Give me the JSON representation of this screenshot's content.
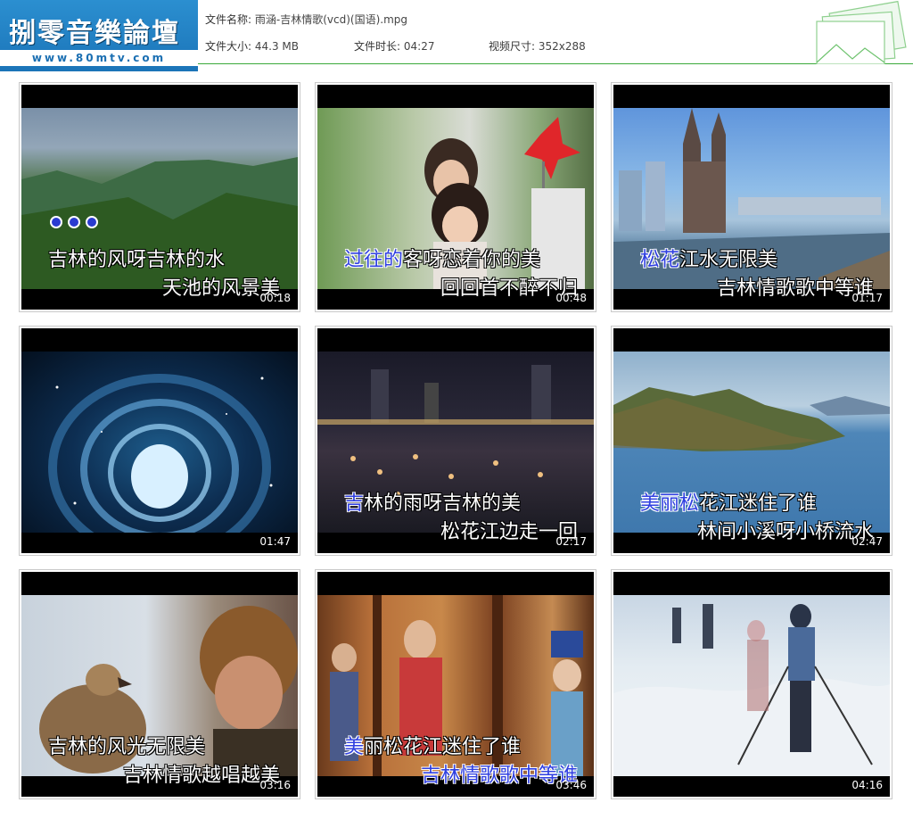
{
  "logo": {
    "title": "捌零音樂論壇",
    "url": "www.80mtv.com"
  },
  "file": {
    "name_label": "文件名称:",
    "name": "雨涵-吉林情歌(vcd)(国语).mpg",
    "size_label": "文件大小:",
    "size": "44.3 MB",
    "duration_label": "文件时长:",
    "duration": "04:27",
    "resolution_label": "视频尺寸:",
    "resolution": "352x288"
  },
  "thumbnails": [
    {
      "time": "00:18",
      "hl1": "",
      "line1": "吉林的风呀吉林的水",
      "line2": "天池的风景美"
    },
    {
      "time": "00:48",
      "hl1": "过往的",
      "line1": "客呀恋着你的美",
      "line2": "回回首不醉不归"
    },
    {
      "time": "01:17",
      "hl1": "松花",
      "line1": "江水无限美",
      "line2": "吉林情歌歌中等谁"
    },
    {
      "time": "01:47",
      "hl1": "",
      "line1": "",
      "line2": ""
    },
    {
      "time": "02:17",
      "hl1": "吉",
      "line1": "林的雨呀吉林的美",
      "line2": "松花江边走一回"
    },
    {
      "time": "02:47",
      "hl1": "美丽松",
      "line1": "花江迷住了谁",
      "line2": "林间小溪呀小桥流水"
    },
    {
      "time": "03:16",
      "hl1": "",
      "line1": "吉林的风光无限美",
      "line2": "吉林情歌越唱越美"
    },
    {
      "time": "03:46",
      "hl1": "美",
      "line1": "丽松花江迷住了谁",
      "line2": "吉林情歌歌中等谁"
    },
    {
      "time": "04:16",
      "hl1": "",
      "line1": "",
      "line2": ""
    }
  ]
}
